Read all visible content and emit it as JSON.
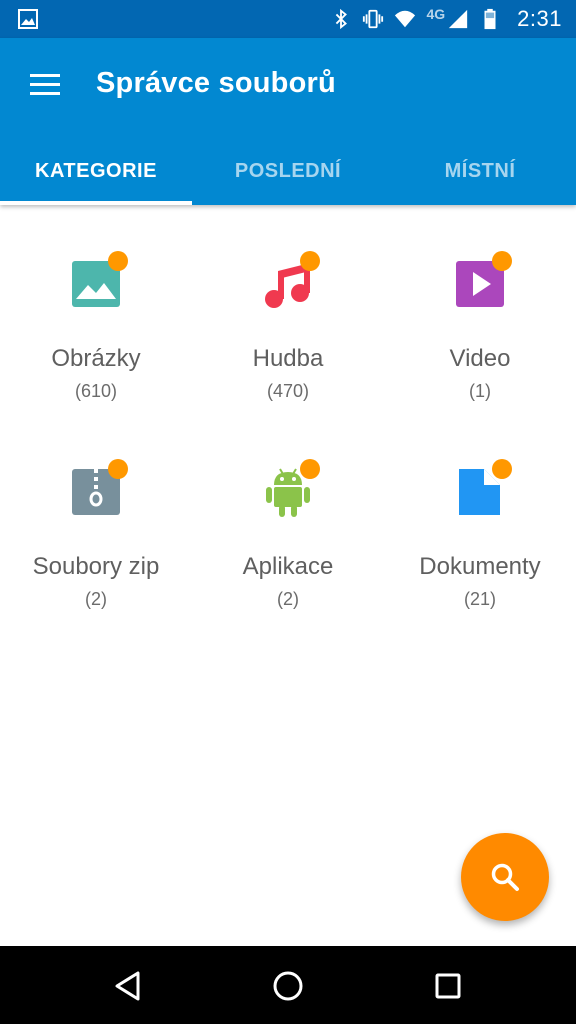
{
  "status_bar": {
    "network": "4G",
    "time": "2:31"
  },
  "app_bar": {
    "title": "Správce souborů",
    "tabs": [
      {
        "label": "KATEGORIE",
        "active": true
      },
      {
        "label": "POSLEDNÍ",
        "active": false
      },
      {
        "label": "MÍSTNÍ",
        "active": false
      }
    ]
  },
  "categories": [
    {
      "name": "Obrázky",
      "count": "(610)",
      "icon": "image-icon",
      "color": "#4DB6AC"
    },
    {
      "name": "Hudba",
      "count": "(470)",
      "icon": "music-note-icon",
      "color": "#F0394F"
    },
    {
      "name": "Video",
      "count": "(1)",
      "icon": "video-play-icon",
      "color": "#AB47BC"
    },
    {
      "name": "Soubory zip",
      "count": "(2)",
      "icon": "zip-file-icon",
      "color": "#78909C"
    },
    {
      "name": "Aplikace",
      "count": "(2)",
      "icon": "android-icon",
      "color": "#8BC34A"
    },
    {
      "name": "Dokumenty",
      "count": "(21)",
      "icon": "document-icon",
      "color": "#2196F3"
    }
  ],
  "colors": {
    "status_bar": "#0267B2",
    "app_bar": "#0288D1",
    "badge": "#FF9800",
    "fab": "#FF8A00"
  }
}
